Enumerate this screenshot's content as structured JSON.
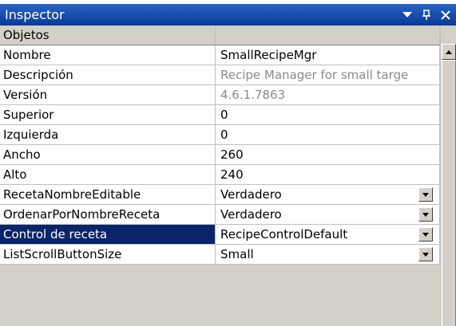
{
  "window": {
    "title": "Inspector",
    "controls": {
      "dropdown_glyph": "▼",
      "pin_glyph": "ᵰ",
      "close_glyph": "✕"
    }
  },
  "grid": {
    "category": "Objetos",
    "rows": [
      {
        "name": "Nombre",
        "value": "SmallRecipeMgr",
        "gray": false,
        "dropdown": false,
        "selected": false
      },
      {
        "name": "Descripción",
        "value": "Recipe Manager for small targe",
        "gray": true,
        "dropdown": false,
        "selected": false
      },
      {
        "name": "Versión",
        "value": "4.6.1.7863",
        "gray": true,
        "dropdown": false,
        "selected": false
      },
      {
        "name": "Superior",
        "value": "0",
        "gray": false,
        "dropdown": false,
        "selected": false
      },
      {
        "name": "Izquierda",
        "value": "0",
        "gray": false,
        "dropdown": false,
        "selected": false
      },
      {
        "name": "Ancho",
        "value": "260",
        "gray": false,
        "dropdown": false,
        "selected": false
      },
      {
        "name": "Alto",
        "value": "240",
        "gray": false,
        "dropdown": false,
        "selected": false
      },
      {
        "name": "RecetaNombreEditable",
        "value": "Verdadero",
        "gray": false,
        "dropdown": true,
        "selected": false
      },
      {
        "name": "OrdenarPorNombreReceta",
        "value": "Verdadero",
        "gray": false,
        "dropdown": true,
        "selected": false
      },
      {
        "name": "Control de receta",
        "value": "RecipeControlDefault",
        "gray": false,
        "dropdown": true,
        "selected": true
      },
      {
        "name": "ListScrollButtonSize",
        "value": "Small",
        "gray": false,
        "dropdown": true,
        "selected": false
      }
    ]
  },
  "colors": {
    "titlebar": "#0a3a95",
    "selection": "#0a246a",
    "readonly_text": "#8a8a8a"
  }
}
